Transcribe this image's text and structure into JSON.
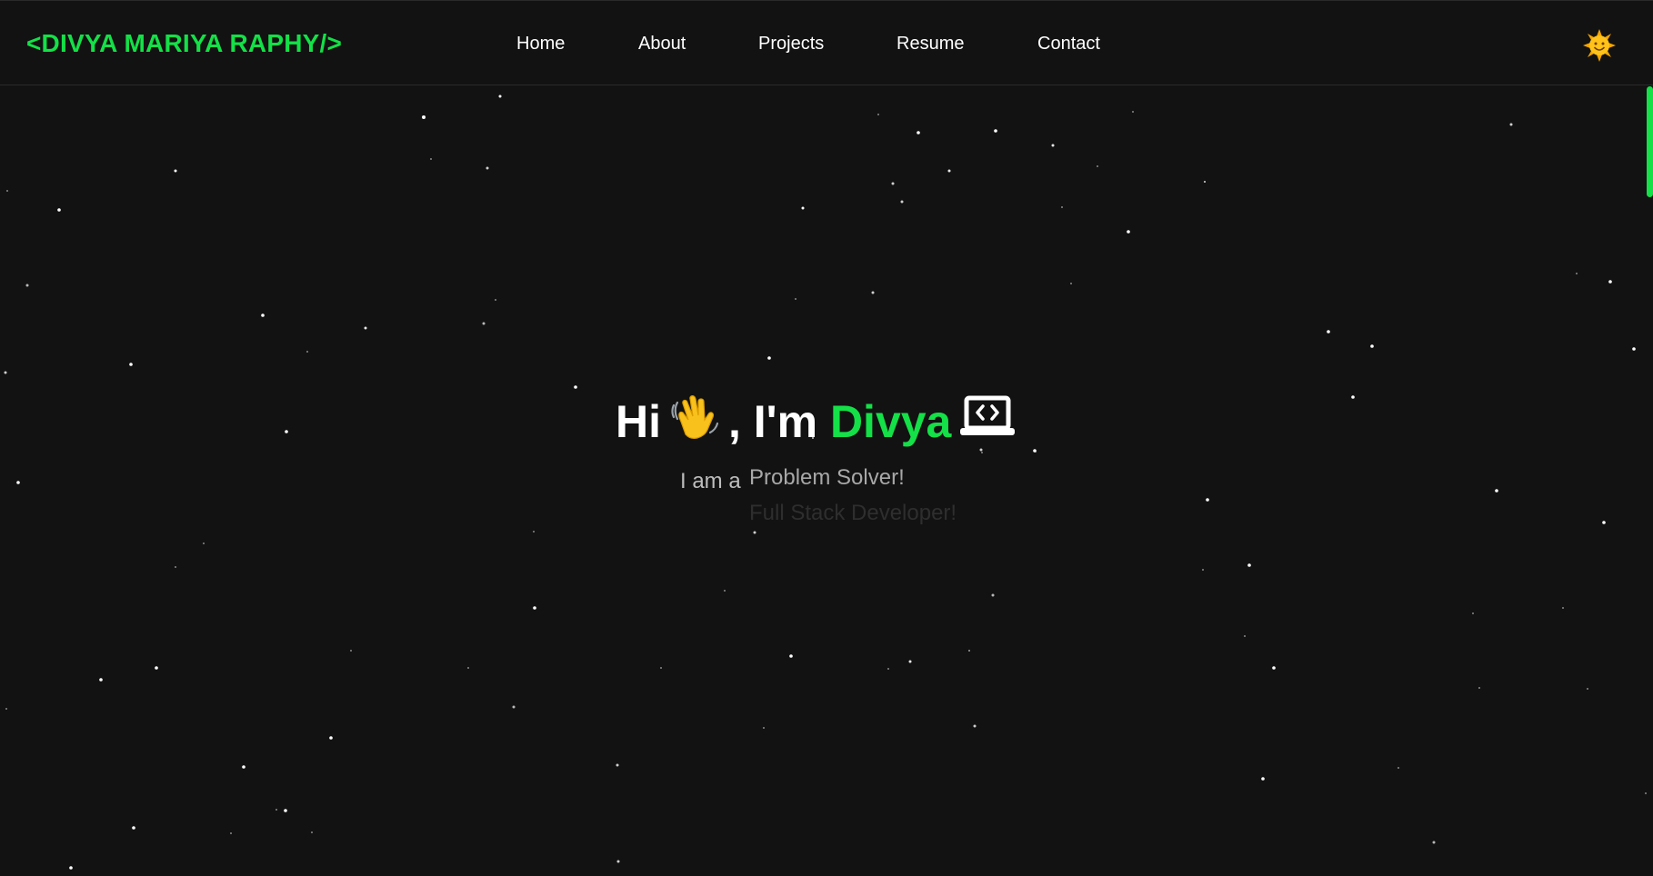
{
  "brand": {
    "logo": "<DIVYA MARIYA RAPHY/>",
    "accent_color": "#14e047"
  },
  "nav": {
    "items": [
      {
        "label": "Home"
      },
      {
        "label": "About"
      },
      {
        "label": "Projects"
      },
      {
        "label": "Resume"
      },
      {
        "label": "Contact"
      }
    ]
  },
  "theme_toggle": {
    "icon": "sun-icon"
  },
  "hero": {
    "greeting": "Hi",
    "wave_icon": "waving-hand-icon",
    "intro": ", I'm",
    "name": "Divya",
    "laptop_icon": "laptop-code-icon",
    "prefix": "I am a",
    "roles": [
      "Problem Solver!",
      "Full Stack Developer!"
    ]
  },
  "colors": {
    "background": "#121212",
    "text": "#ffffff",
    "muted": "#a8a8a8"
  }
}
